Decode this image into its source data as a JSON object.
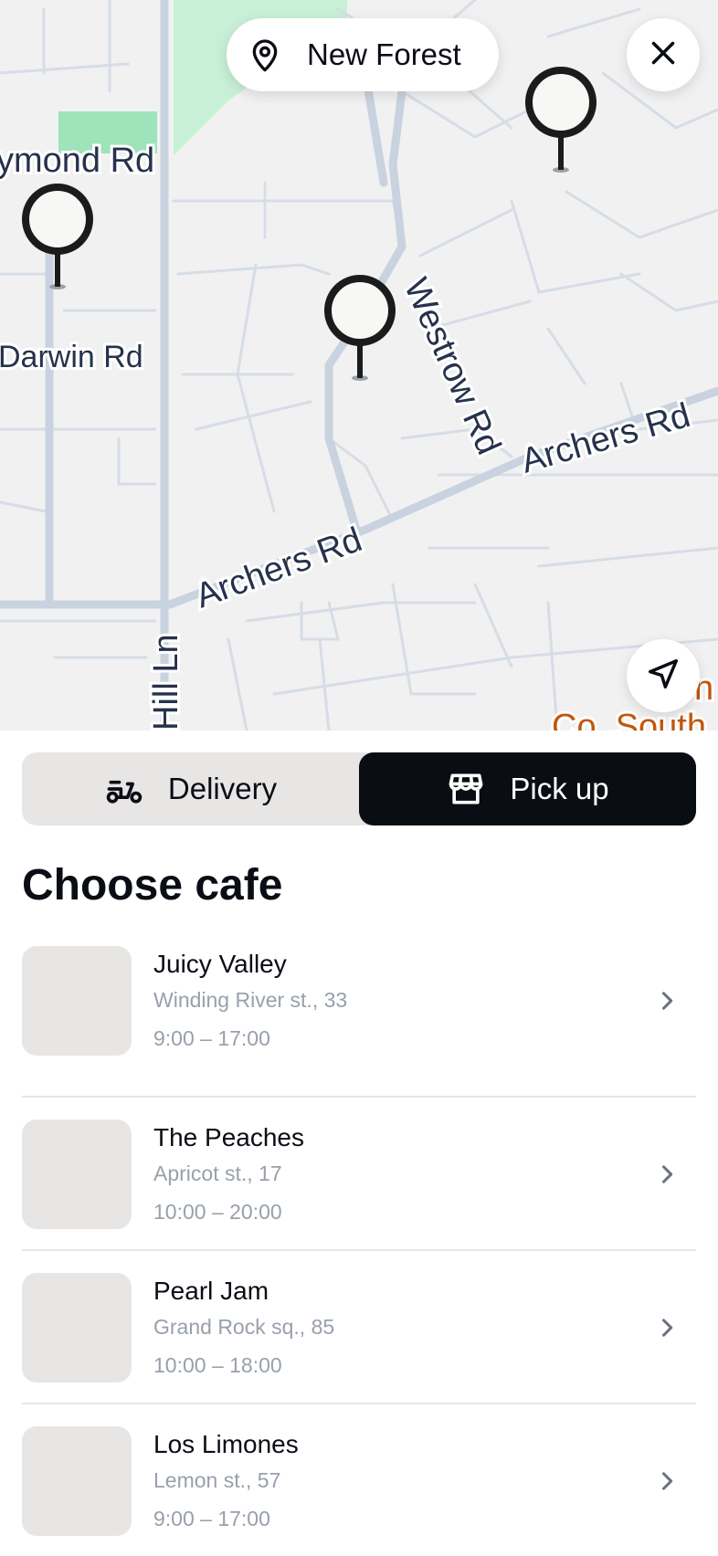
{
  "map": {
    "location_label": "New Forest",
    "streets": {
      "raymond": "ymond Rd",
      "darwin": "Darwin Rd",
      "westrow": "Westrow Rd",
      "archers_1": "Archers Rd",
      "archers_2": "Archers Rd",
      "hill": "Hill Ln",
      "poi_1": "n",
      "poi_2": "Co. South"
    },
    "icons": {
      "location": "map-pin-icon",
      "close": "close-icon",
      "locate": "navigation-arrow-icon",
      "marker": "map-marker-icon"
    }
  },
  "mode": {
    "delivery_label": "Delivery",
    "pickup_label": "Pick up",
    "selected": "pickup",
    "delivery_icon": "scooter-icon",
    "pickup_icon": "store-icon"
  },
  "section_title": "Choose cafe",
  "cafes": [
    {
      "name": "Juicy Valley",
      "address": "Winding River st., 33",
      "hours": "9:00 – 17:00"
    },
    {
      "name": "The Peaches",
      "address": "Apricot st., 17",
      "hours": "10:00 – 20:00"
    },
    {
      "name": "Pearl Jam",
      "address": "Grand Rock sq., 85",
      "hours": "10:00 – 18:00"
    },
    {
      "name": "Los Limones",
      "address": "Lemon st., 57",
      "hours": "9:00 – 17:00"
    }
  ],
  "colors": {
    "primary": "#0a0d14",
    "segment_bg": "#e7e6e5",
    "muted_text": "#98a0ab",
    "map_bg": "#f1f1f2",
    "map_road": "#c9d3df",
    "map_park": "#9ee3b9",
    "street_label": "#26324c",
    "poi_label": "#c2570c"
  }
}
